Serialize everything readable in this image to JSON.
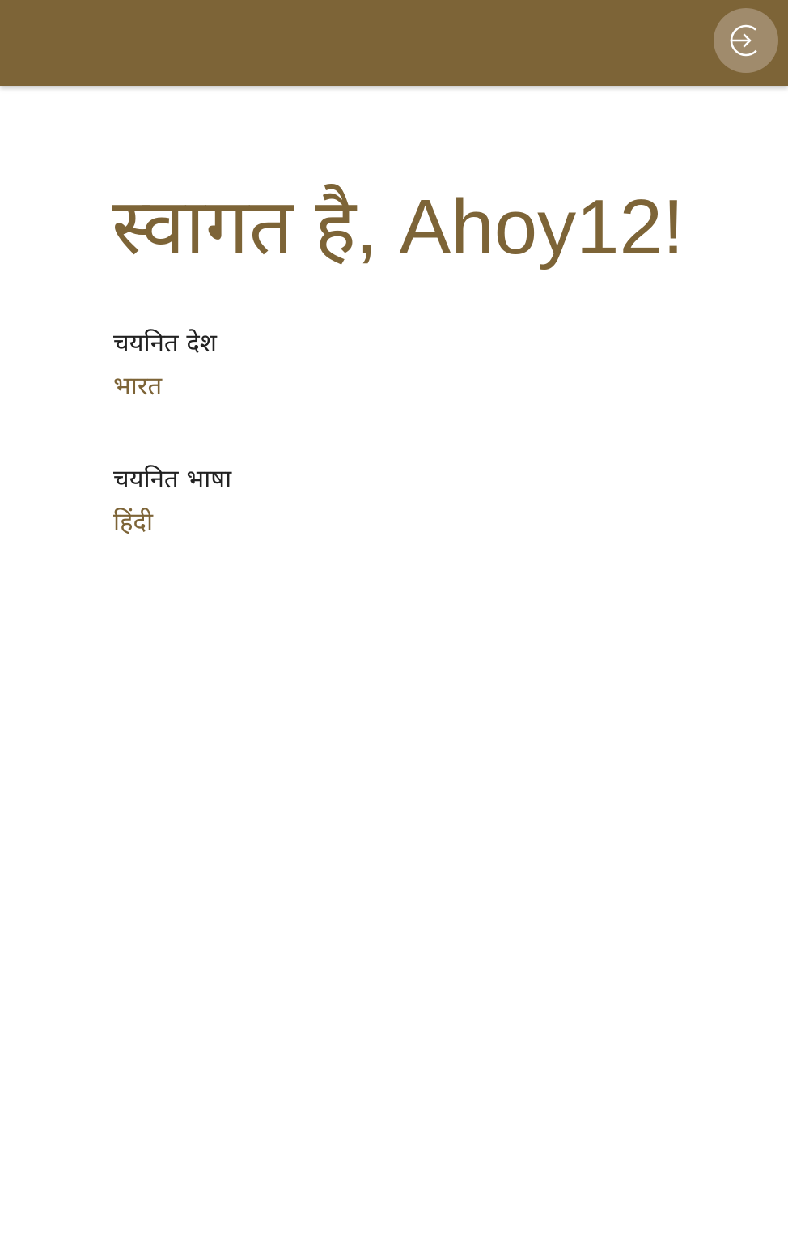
{
  "header": {
    "background_color": "#7d6437",
    "login_icon": "login-icon"
  },
  "main": {
    "welcome": "स्वागत है, Ahoy12!",
    "country": {
      "label": "चयनित देश",
      "value": "भारत"
    },
    "language": {
      "label": "चयनित भाषा",
      "value": "हिंदी"
    }
  },
  "colors": {
    "accent": "#7d6437",
    "text": "#212121",
    "button_bg": "#a08b6c"
  }
}
